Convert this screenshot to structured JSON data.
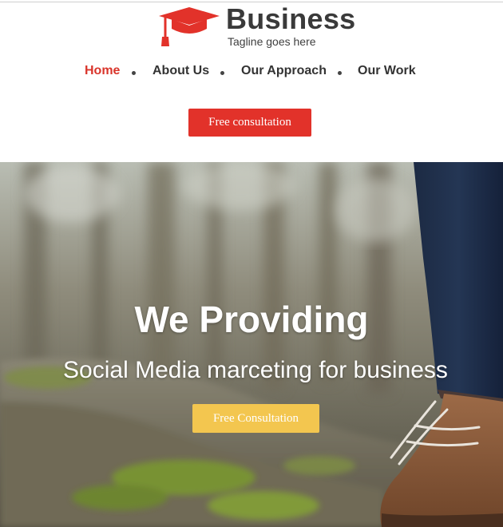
{
  "brand": {
    "name": "Business",
    "tagline": "Tagline goes here",
    "logo_icon": "graduation-cap-icon",
    "logo_color": "#e2322a"
  },
  "nav": {
    "items": [
      {
        "label": "Home",
        "active": true
      },
      {
        "label": "About Us",
        "active": false
      },
      {
        "label": "Our Approach",
        "active": false
      },
      {
        "label": "Our Work",
        "active": false
      }
    ]
  },
  "cta_top": {
    "label": "Free consultation",
    "color": "#e2322a"
  },
  "hero": {
    "title": "We Providing",
    "subtitle": "Social Media marceting for business",
    "cta_label": "Free Consultation",
    "cta_color": "#f3c64f"
  },
  "colors": {
    "accent": "#d9352b",
    "text": "#333333"
  }
}
